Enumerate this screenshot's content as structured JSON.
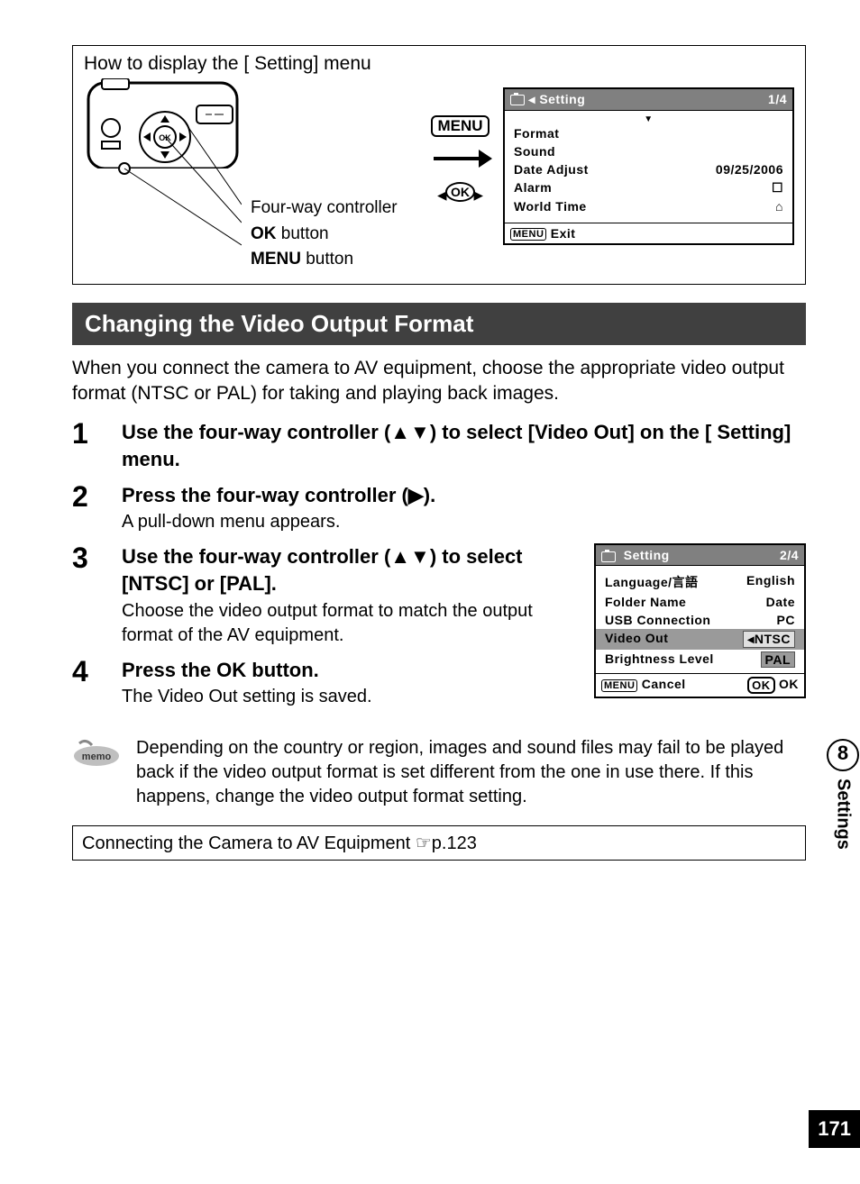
{
  "instructionBox": {
    "title": "How to display the [ Setting] menu",
    "callouts": {
      "fourway": "Four-way controller",
      "ok": "button",
      "okLabel": "OK",
      "menu": "button",
      "menuLabel": "MENU"
    },
    "menuButton": "MENU",
    "okButton": "OK"
  },
  "lcd1": {
    "headerTitle": "Setting",
    "headerPage": "1/4",
    "rows": [
      {
        "label": "Format",
        "value": ""
      },
      {
        "label": "Sound",
        "value": ""
      },
      {
        "label": "Date Adjust",
        "value": "09/25/2006"
      },
      {
        "label": "Alarm",
        "value": "☐"
      },
      {
        "label": "World Time",
        "value": "⌂"
      }
    ],
    "footerLeft": "Exit",
    "footerMenu": "MENU"
  },
  "sectionHeading": "Changing the Video Output Format",
  "intro": "When you connect the camera to AV equipment, choose the appropriate video output format (NTSC or PAL) for taking and playing back images.",
  "steps": [
    {
      "num": "1",
      "title": "Use the four-way controller (▲▼) to select [Video Out] on the [ Setting] menu.",
      "desc": ""
    },
    {
      "num": "2",
      "title": "Press the four-way controller (▶).",
      "desc": "A pull-down menu appears."
    },
    {
      "num": "3",
      "title": "Use the four-way controller (▲▼) to select [NTSC] or [PAL].",
      "desc": "Choose the video output format to match the output format of the AV equipment."
    },
    {
      "num": "4",
      "title": "Press the OK button.",
      "desc": "The Video Out setting is saved."
    }
  ],
  "lcd2": {
    "headerTitle": "Setting",
    "headerPage": "2/4",
    "rows": {
      "language": {
        "label": "Language/言語",
        "value": "English"
      },
      "folder": {
        "label": "Folder Name",
        "value": "Date"
      },
      "usb": {
        "label": "USB Connection",
        "value": "PC"
      },
      "video": {
        "label": "Video Out",
        "value": "NTSC"
      },
      "bright": {
        "label": "Brightness Level",
        "value": "PAL"
      }
    },
    "footerCancel": "Cancel",
    "footerMenu": "MENU",
    "footerOkBox": "OK",
    "footerOk": "OK"
  },
  "memo": {
    "label": "memo",
    "text": "Depending on the country or region, images and sound files may fail to be played back if the video output format is set different from the one in use there. If this happens, change the video output format setting."
  },
  "refBox": "Connecting the Camera to AV Equipment ☞p.123",
  "sideTab": {
    "num": "8",
    "label": "Settings"
  },
  "pageNum": "171"
}
